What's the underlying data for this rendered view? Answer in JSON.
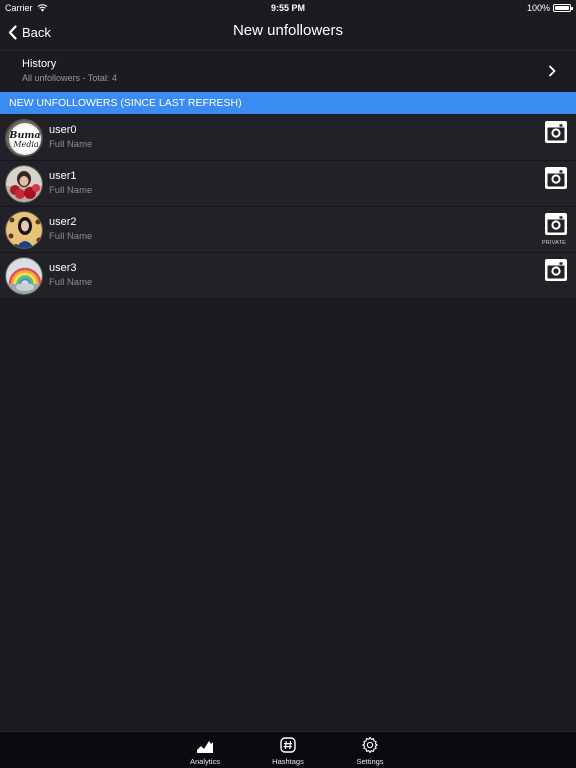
{
  "status_bar": {
    "carrier": "Carrier",
    "time": "9:55 PM",
    "battery_text": "100%",
    "battery_level": 1.0
  },
  "nav": {
    "back_label": "Back",
    "title": "New unfollowers"
  },
  "history": {
    "title": "History",
    "subtitle": "All unfollowers - Total: 4"
  },
  "section": {
    "header": "NEW UNFOLLOWERS (SINCE LAST REFRESH)"
  },
  "users": [
    {
      "username": "user0",
      "full_name": "Full Name",
      "private": false,
      "avatar_text_line1": "Buma",
      "avatar_text_line2": "Media",
      "action_icon": "instagram-icon"
    },
    {
      "username": "user1",
      "full_name": "Full Name",
      "private": false,
      "action_icon": "instagram-icon"
    },
    {
      "username": "user2",
      "full_name": "Full Name",
      "private": true,
      "private_label": "PRIVATE",
      "action_icon": "instagram-icon"
    },
    {
      "username": "user3",
      "full_name": "Full Name",
      "private": false,
      "action_icon": "instagram-icon"
    }
  ],
  "tabs": [
    {
      "label": "Analytics",
      "icon": "analytics-icon"
    },
    {
      "label": "Hashtags",
      "icon": "hashtag-icon"
    },
    {
      "label": "Settings",
      "icon": "gear-icon"
    }
  ],
  "colors": {
    "background": "#1c1b22",
    "row": "#222128",
    "accent": "#3b8cf2",
    "tab_bar": "#0b0b0f",
    "secondary_text": "#8b8b93"
  }
}
